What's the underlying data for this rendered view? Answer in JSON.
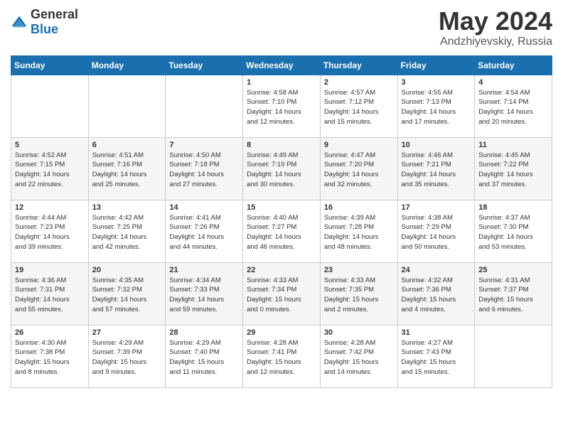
{
  "logo": {
    "general": "General",
    "blue": "Blue"
  },
  "title": "May 2024",
  "location": "Andzhiyevskiy, Russia",
  "days_header": [
    "Sunday",
    "Monday",
    "Tuesday",
    "Wednesday",
    "Thursday",
    "Friday",
    "Saturday"
  ],
  "weeks": [
    [
      {
        "num": "",
        "info": ""
      },
      {
        "num": "",
        "info": ""
      },
      {
        "num": "",
        "info": ""
      },
      {
        "num": "1",
        "info": "Sunrise: 4:58 AM\nSunset: 7:10 PM\nDaylight: 14 hours\nand 12 minutes."
      },
      {
        "num": "2",
        "info": "Sunrise: 4:57 AM\nSunset: 7:12 PM\nDaylight: 14 hours\nand 15 minutes."
      },
      {
        "num": "3",
        "info": "Sunrise: 4:55 AM\nSunset: 7:13 PM\nDaylight: 14 hours\nand 17 minutes."
      },
      {
        "num": "4",
        "info": "Sunrise: 4:54 AM\nSunset: 7:14 PM\nDaylight: 14 hours\nand 20 minutes."
      }
    ],
    [
      {
        "num": "5",
        "info": "Sunrise: 4:52 AM\nSunset: 7:15 PM\nDaylight: 14 hours\nand 22 minutes."
      },
      {
        "num": "6",
        "info": "Sunrise: 4:51 AM\nSunset: 7:16 PM\nDaylight: 14 hours\nand 25 minutes."
      },
      {
        "num": "7",
        "info": "Sunrise: 4:50 AM\nSunset: 7:18 PM\nDaylight: 14 hours\nand 27 minutes."
      },
      {
        "num": "8",
        "info": "Sunrise: 4:49 AM\nSunset: 7:19 PM\nDaylight: 14 hours\nand 30 minutes."
      },
      {
        "num": "9",
        "info": "Sunrise: 4:47 AM\nSunset: 7:20 PM\nDaylight: 14 hours\nand 32 minutes."
      },
      {
        "num": "10",
        "info": "Sunrise: 4:46 AM\nSunset: 7:21 PM\nDaylight: 14 hours\nand 35 minutes."
      },
      {
        "num": "11",
        "info": "Sunrise: 4:45 AM\nSunset: 7:22 PM\nDaylight: 14 hours\nand 37 minutes."
      }
    ],
    [
      {
        "num": "12",
        "info": "Sunrise: 4:44 AM\nSunset: 7:23 PM\nDaylight: 14 hours\nand 39 minutes."
      },
      {
        "num": "13",
        "info": "Sunrise: 4:42 AM\nSunset: 7:25 PM\nDaylight: 14 hours\nand 42 minutes."
      },
      {
        "num": "14",
        "info": "Sunrise: 4:41 AM\nSunset: 7:26 PM\nDaylight: 14 hours\nand 44 minutes."
      },
      {
        "num": "15",
        "info": "Sunrise: 4:40 AM\nSunset: 7:27 PM\nDaylight: 14 hours\nand 46 minutes."
      },
      {
        "num": "16",
        "info": "Sunrise: 4:39 AM\nSunset: 7:28 PM\nDaylight: 14 hours\nand 48 minutes."
      },
      {
        "num": "17",
        "info": "Sunrise: 4:38 AM\nSunset: 7:29 PM\nDaylight: 14 hours\nand 50 minutes."
      },
      {
        "num": "18",
        "info": "Sunrise: 4:37 AM\nSunset: 7:30 PM\nDaylight: 14 hours\nand 53 minutes."
      }
    ],
    [
      {
        "num": "19",
        "info": "Sunrise: 4:36 AM\nSunset: 7:31 PM\nDaylight: 14 hours\nand 55 minutes."
      },
      {
        "num": "20",
        "info": "Sunrise: 4:35 AM\nSunset: 7:32 PM\nDaylight: 14 hours\nand 57 minutes."
      },
      {
        "num": "21",
        "info": "Sunrise: 4:34 AM\nSunset: 7:33 PM\nDaylight: 14 hours\nand 59 minutes."
      },
      {
        "num": "22",
        "info": "Sunrise: 4:33 AM\nSunset: 7:34 PM\nDaylight: 15 hours\nand 0 minutes."
      },
      {
        "num": "23",
        "info": "Sunrise: 4:33 AM\nSunset: 7:35 PM\nDaylight: 15 hours\nand 2 minutes."
      },
      {
        "num": "24",
        "info": "Sunrise: 4:32 AM\nSunset: 7:36 PM\nDaylight: 15 hours\nand 4 minutes."
      },
      {
        "num": "25",
        "info": "Sunrise: 4:31 AM\nSunset: 7:37 PM\nDaylight: 15 hours\nand 6 minutes."
      }
    ],
    [
      {
        "num": "26",
        "info": "Sunrise: 4:30 AM\nSunset: 7:38 PM\nDaylight: 15 hours\nand 8 minutes."
      },
      {
        "num": "27",
        "info": "Sunrise: 4:29 AM\nSunset: 7:39 PM\nDaylight: 15 hours\nand 9 minutes."
      },
      {
        "num": "28",
        "info": "Sunrise: 4:29 AM\nSunset: 7:40 PM\nDaylight: 15 hours\nand 11 minutes."
      },
      {
        "num": "29",
        "info": "Sunrise: 4:28 AM\nSunset: 7:41 PM\nDaylight: 15 hours\nand 12 minutes."
      },
      {
        "num": "30",
        "info": "Sunrise: 4:28 AM\nSunset: 7:42 PM\nDaylight: 15 hours\nand 14 minutes."
      },
      {
        "num": "31",
        "info": "Sunrise: 4:27 AM\nSunset: 7:43 PM\nDaylight: 15 hours\nand 15 minutes."
      },
      {
        "num": "",
        "info": ""
      }
    ]
  ]
}
